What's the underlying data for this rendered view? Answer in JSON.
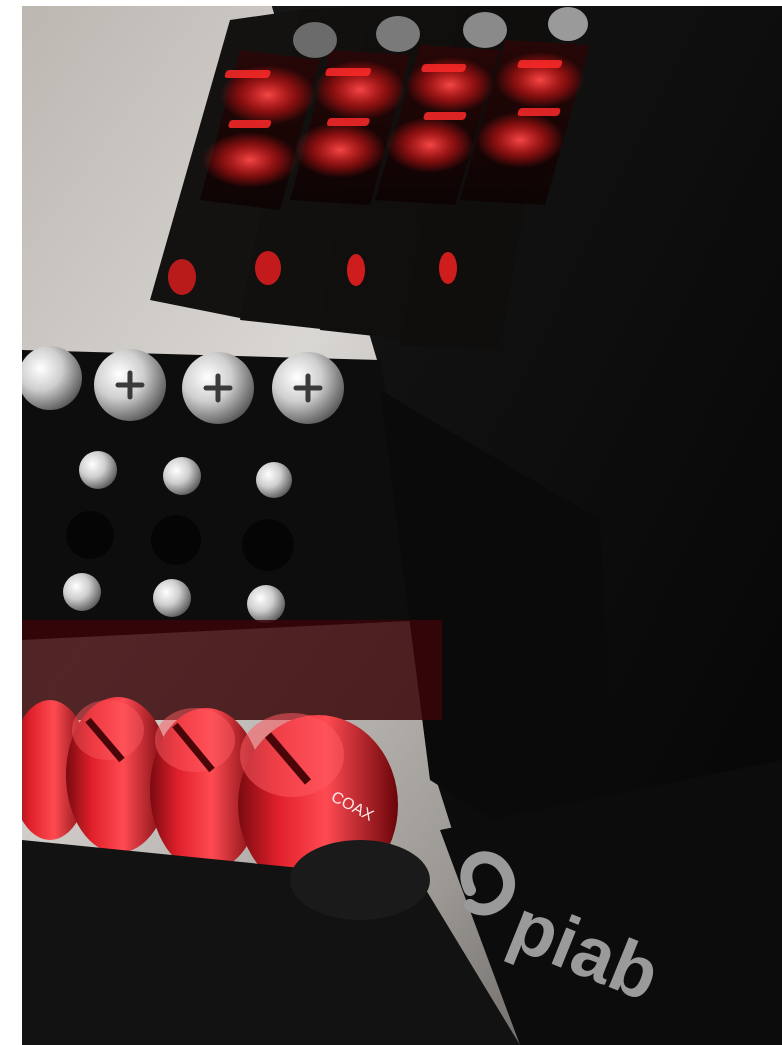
{
  "photo": {
    "subject_marks": {
      "coax_label": "COAX",
      "brand_logo_text": "piab"
    },
    "colors": {
      "frame_border": "#ffffff",
      "background_light": "#d8d6d4",
      "background_dark": "#2c2c2c",
      "body_black": "#0b0b0b",
      "accent_red": "#e0202a",
      "led_red": "#ff1a1a",
      "metal": "#c8c8c8",
      "logo_gray": "#8a8a8a"
    },
    "icons": [
      "screw-icon",
      "led-digit-icon",
      "brand-logo-icon"
    ]
  }
}
